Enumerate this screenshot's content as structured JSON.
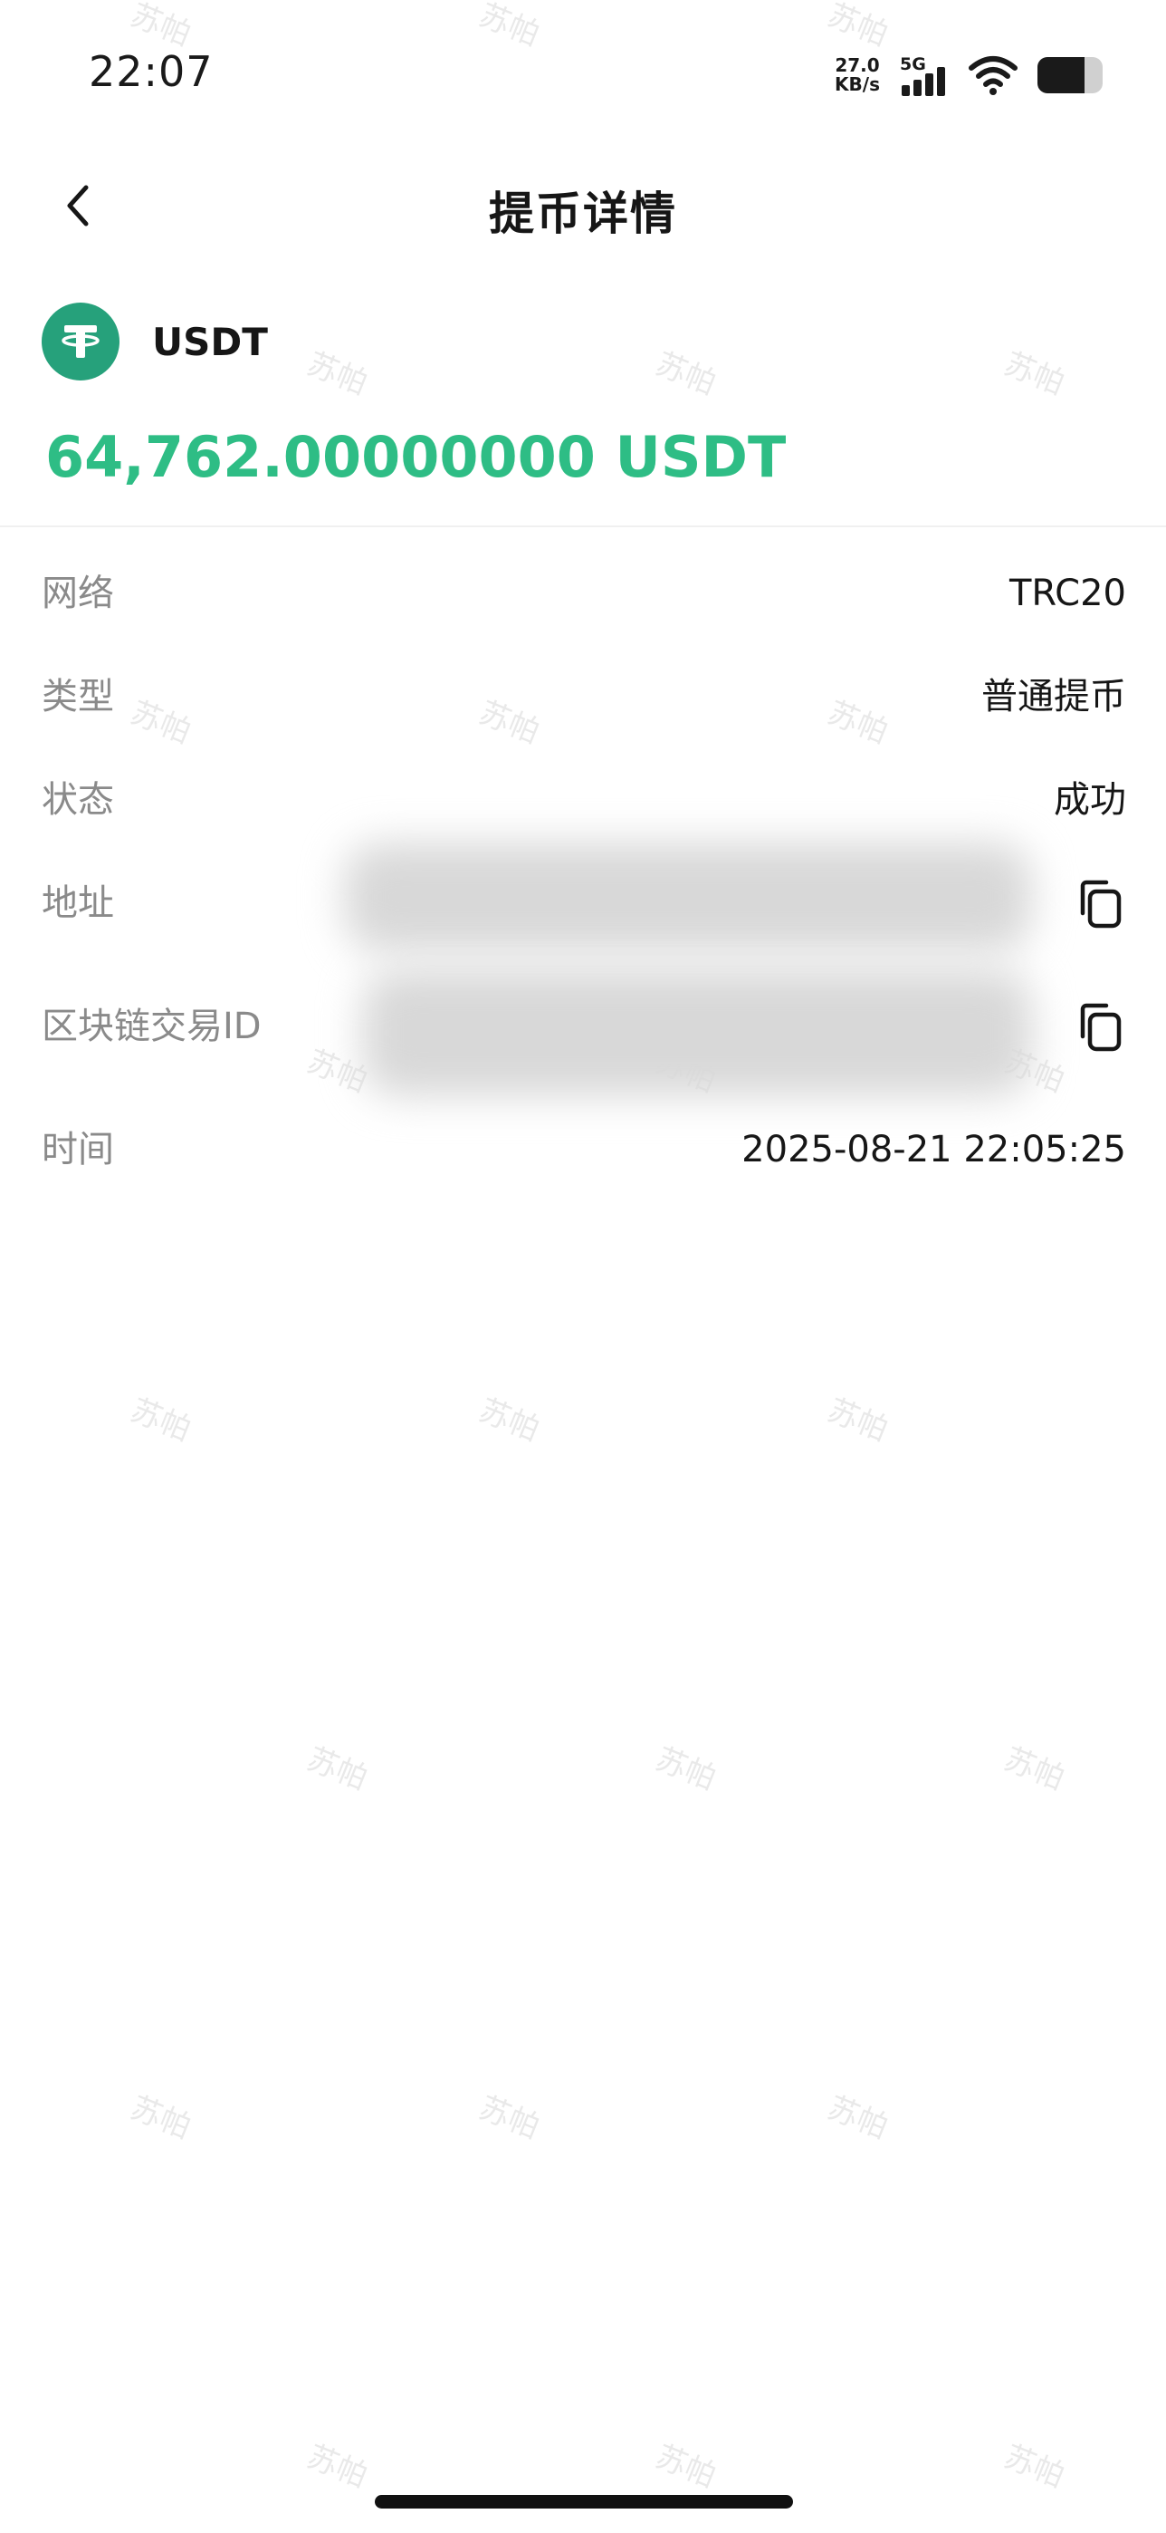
{
  "status_bar": {
    "time": "22:07",
    "net_speed_value": "27.0",
    "net_speed_unit": "KB/s",
    "network_type": "5G",
    "signal_level": 4,
    "battery_level": 0.72,
    "icons": [
      "signal-icon",
      "wifi-icon",
      "battery-icon"
    ]
  },
  "header": {
    "title": "提币详情",
    "back_icon": "chevron-left-icon"
  },
  "coin": {
    "name": "USDT",
    "logo_icon": "tether-icon",
    "amount": "64,762.00000000 USDT"
  },
  "details": {
    "network_label": "网络",
    "network_value": "TRC20",
    "type_label": "类型",
    "type_value": "普通提币",
    "status_label": "状态",
    "status_value": "成功",
    "address_label": "地址",
    "address_value": "",
    "txid_label": "区块链交易ID",
    "txid_value": "",
    "time_label": "时间",
    "time_value": "2025-08-21 22:05:25"
  },
  "watermark_text": "苏帕",
  "colors": {
    "accent_green": "#2ebd85",
    "tether_green": "#26a17b",
    "label_gray": "#8a8a8a",
    "text_dark": "#161616"
  }
}
